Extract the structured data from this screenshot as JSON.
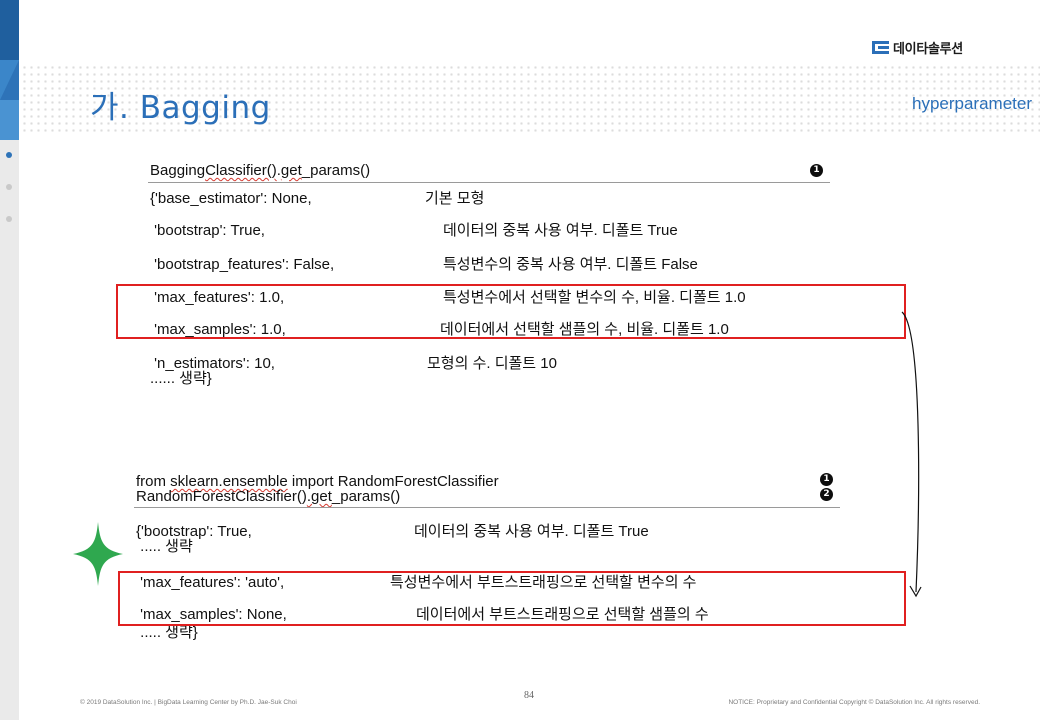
{
  "brand": {
    "name": "데이타솔루션",
    "accent": "#2b6fb8"
  },
  "slide": {
    "title": "가. Bagging",
    "subtitle": "hyperparameter",
    "page_number": "84"
  },
  "block1": {
    "header_prefix": "Bagging",
    "header_underlined": "Classifier()",
    "header_mid": ".",
    "header_underlined2": "get",
    "header_suffix": "_params()",
    "badge": "1",
    "rows": [
      {
        "key": "{'base_estimator': None,",
        "desc": "기본 모형"
      },
      {
        "key": " 'bootstrap': True,",
        "desc": "데이터의 중복 사용 여부. 디폴트 True"
      },
      {
        "key": " 'bootstrap_features': False,",
        "desc": "특성변수의 중복 사용 여부. 디폴트 False"
      },
      {
        "key": " 'max_features': 1.0,",
        "desc": "특성변수에서 선택할 변수의 수, 비율. 디폴트 1.0"
      },
      {
        "key": " 'max_samples': 1.0,",
        "desc": "데이터에서 선택할 샘플의 수, 비율. 디폴트 1.0"
      },
      {
        "key": " 'n_estimators': 10,",
        "desc": "모형의 수. 디폴트 10"
      }
    ],
    "ellipsis": "...... 생략}"
  },
  "block2": {
    "line1_prefix": "from ",
    "line1_underlined": "sklearn.ensemble",
    "line1_suffix": " import RandomForestClassifier",
    "line2_prefix": "RandomForestClassifier()",
    "line2_underlined": ".get",
    "line2_suffix": "_params()",
    "badge1": "1",
    "badge2": "2",
    "rows": [
      {
        "key": "{'bootstrap': True,",
        "desc": "데이터의 중복 사용 여부. 디폴트 True"
      },
      {
        "key": " 'max_features': 'auto',",
        "desc": "특성변수에서 부트스트래핑으로 선택할 변수의 수"
      },
      {
        "key": " 'max_samples': None,",
        "desc": "데이터에서 부트스트래핑으로 선택할 샘플의 수"
      }
    ],
    "ellipsis1": " ..... 생략",
    "ellipsis2": " ..... 생략}"
  },
  "footer": {
    "left": "© 2019 DataSolution Inc. | BigData Learning Center by Ph.D. Jae-Suk Choi",
    "right": "NOTICE: Proprietary and Confidential Copyright © DataSolution Inc. All rights reserved."
  }
}
